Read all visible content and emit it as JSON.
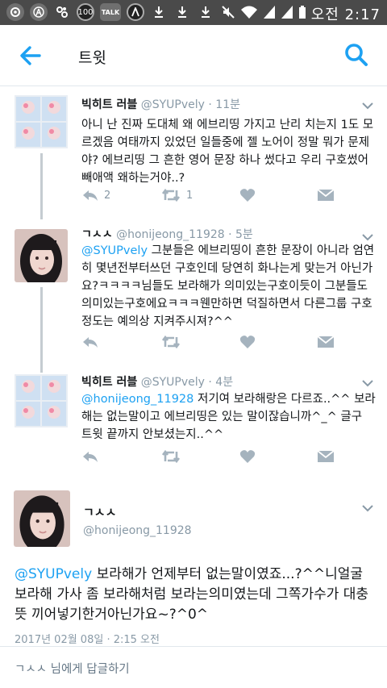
{
  "status_bar": {
    "time": "오전 2:17",
    "badge_100": "100",
    "badge_talk": "TALK",
    "icons": [
      "settings-icon",
      "accessibility-icon",
      "link-icon",
      "100-badge-icon",
      "talk-icon",
      "app-icon",
      "download-icon",
      "download-icon",
      "download-icon",
      "mute-icon",
      "wifi-icon",
      "signal-icon",
      "signal-icon",
      "battery-icon"
    ]
  },
  "app_bar": {
    "title": "트윗",
    "back_icon": "arrow-left-icon",
    "search_icon": "search-icon",
    "accent": "#1da1f2"
  },
  "thread": [
    {
      "name": "빅히트 러블",
      "handle": "@SYUPvely",
      "time": "· 11분",
      "mention": "",
      "text": "아니 난 진짜 도대체 왜 에브리띵 가지고 난리 치는지 1도 모르겠음 여태까지 있었던 일들중에 젤 노어이 정말 뭐가 문제야? 에브리띵 그 흔한 영어 문장 하나 썼다고 우리 구호썼어 빼애액 왜하는거야..?",
      "reply_count": "2",
      "retweet_count": "1",
      "like_count": ""
    },
    {
      "name": "ㄱㅅㅅ",
      "handle": "@honijeong_11928",
      "time": "· 5분",
      "mention": "@SYUPvely",
      "text": " 그분들은 에브리띵이 흔한 문장이 아니라 엄연히 몇년전부터쓰던 구호인데 당연히 화나는게 맞는거 아닌가요?ㅋㅋㅋㅋ님들도 보라해가 의미있는구호이듯이 그분들도 의미있는구호에요ㅋㅋㅋ웬만하면 덕질하면서 다른그룹 구호정도는 예의상 지켜주시져?^^",
      "reply_count": "",
      "retweet_count": "",
      "like_count": ""
    },
    {
      "name": "빅히트 러블",
      "handle": "@SYUPvely",
      "time": "· 4분",
      "mention": "@honijeong_11928",
      "text": " 저기여 보라해랑은 다르죠..^^ 보라해는 없는말이고 에브리띵은 있는 말이잖습니까^_^ 글구 트윗 끝까지 안보셨는지..^^",
      "reply_count": "",
      "retweet_count": "",
      "like_count": ""
    }
  ],
  "main_tweet": {
    "name": "ㄱㅅㅅ",
    "handle": "@honijeong_11928",
    "mention": "@SYUPvely",
    "text": " 보라해가 언제부터 없는말이였죠...?^^니얼굴 보라해 가사 좀 보라해처럼 보라는의미였는데 그쪽가수가 대충 뜻 끼어넣기한거아닌가요~?^0^",
    "timestamp": "2017년 02월 08일 · 2:15 오전"
  },
  "reply_box": {
    "placeholder": "ㄱㅅㅅ 님에게 답글하기"
  }
}
